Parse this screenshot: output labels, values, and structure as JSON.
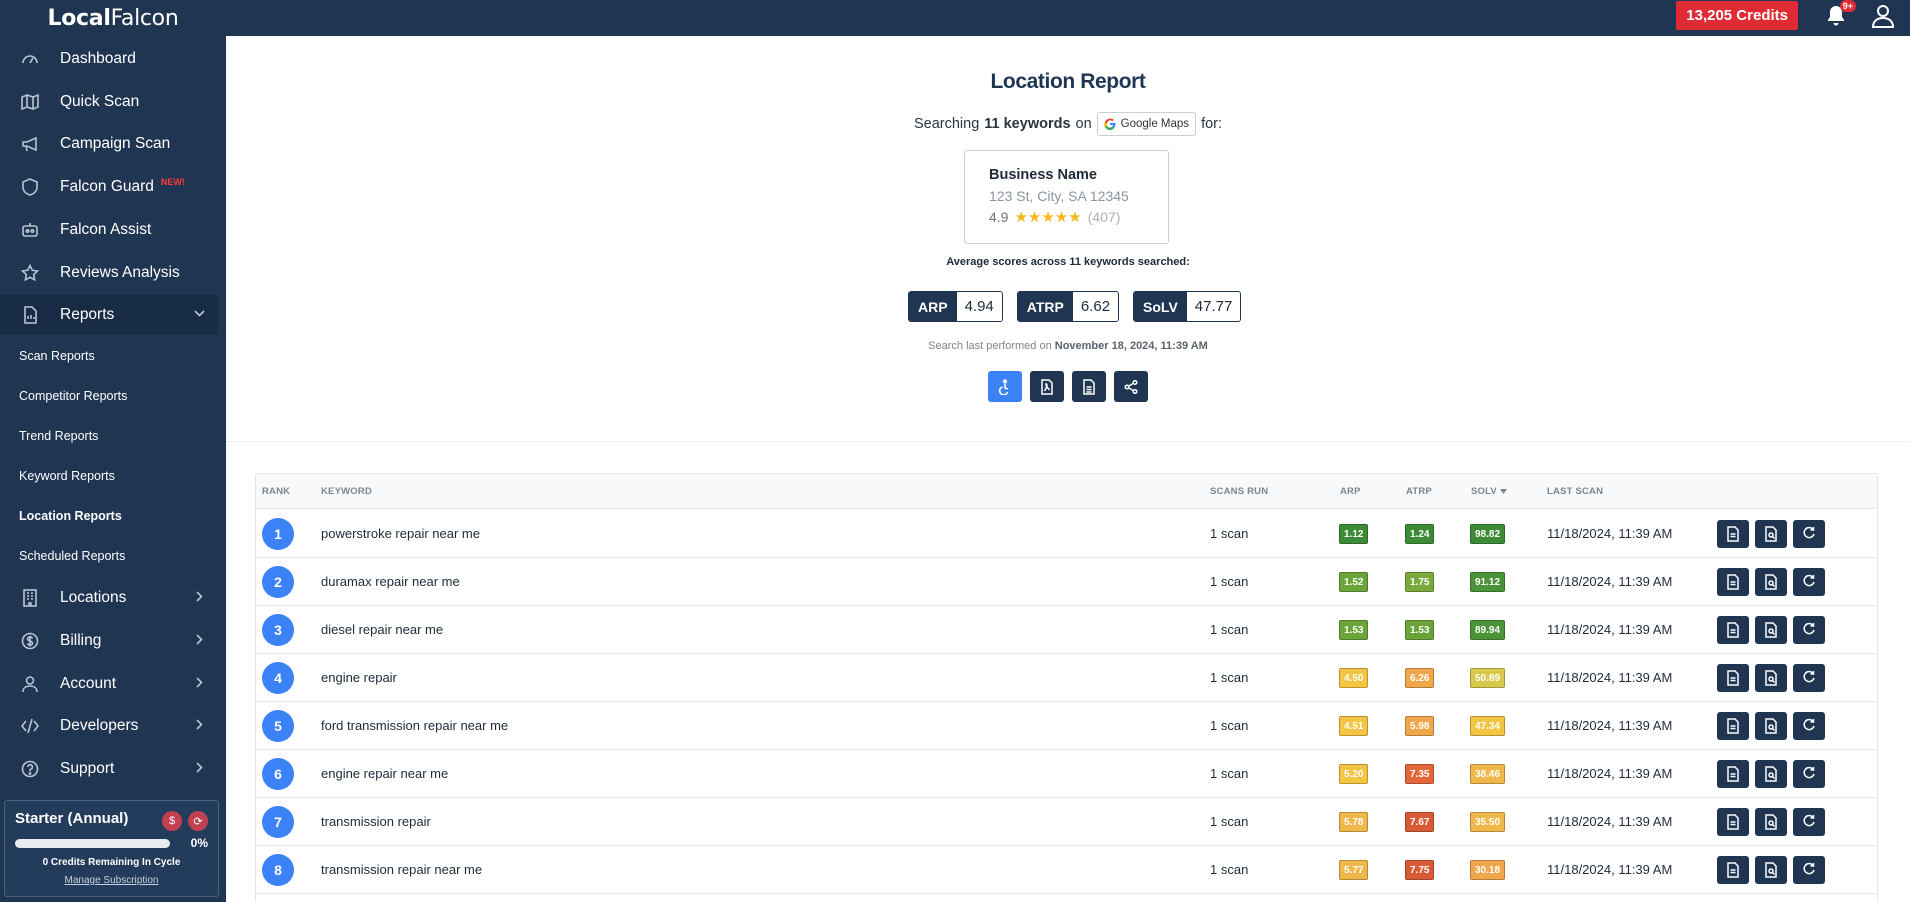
{
  "app": {
    "logo_bold": "Local",
    "logo_rest": "Falcon"
  },
  "topbar": {
    "credits": "13,205 Credits",
    "notification_count": "9+"
  },
  "sidebar": {
    "items": [
      {
        "label": "Dashboard",
        "icon": "gauge-icon"
      },
      {
        "label": "Quick Scan",
        "icon": "map-icon"
      },
      {
        "label": "Campaign Scan",
        "icon": "megaphone-icon"
      },
      {
        "label": "Falcon Guard",
        "icon": "shield-icon",
        "badge": "NEW!"
      },
      {
        "label": "Falcon Assist",
        "icon": "robot-icon"
      },
      {
        "label": "Reviews Analysis",
        "icon": "star-icon"
      },
      {
        "label": "Reports",
        "icon": "report-icon"
      },
      {
        "label": "Locations",
        "icon": "building-icon"
      },
      {
        "label": "Billing",
        "icon": "dollar-icon"
      },
      {
        "label": "Account",
        "icon": "user-icon"
      },
      {
        "label": "Developers",
        "icon": "code-icon"
      },
      {
        "label": "Support",
        "icon": "help-icon"
      }
    ],
    "report_sub": [
      "Scan Reports",
      "Competitor Reports",
      "Trend Reports",
      "Keyword Reports",
      "Location Reports",
      "Scheduled Reports"
    ],
    "plan": {
      "name": "Starter (Annual)",
      "percent": "0%",
      "credits_text": "0 Credits Remaining In Cycle",
      "manage": "Manage Subscription",
      "progress": 0
    }
  },
  "report": {
    "title": "Location Report",
    "searching_prefix": "Searching",
    "keywords_count": "11 keywords",
    "on": "on",
    "platform": "Google Maps",
    "for": "for:",
    "business": {
      "name": "Business Name",
      "address": "123 St, City, SA 12345",
      "rating": "4.9",
      "stars": "★★★★★",
      "review_count": "(407)"
    },
    "avg_text": "Average scores across 11 keywords searched:",
    "scores": [
      {
        "label": "ARP",
        "value": "4.94"
      },
      {
        "label": "ATRP",
        "value": "6.62"
      },
      {
        "label": "SoLV",
        "value": "47.77"
      }
    ],
    "last_performed_prefix": "Search last performed on",
    "last_performed_date": "November 18, 2024, 11:39 AM"
  },
  "table": {
    "headers": {
      "rank": "RANK",
      "keyword": "KEYWORD",
      "scans": "SCANS RUN",
      "arp": "ARP",
      "atrp": "ATRP",
      "solv": "SOLV",
      "last": "LAST SCAN"
    },
    "sort_icon": "caret-down-icon",
    "rows": [
      {
        "rank": "1",
        "keyword": "powerstroke repair near me",
        "scans": "1 scan",
        "arp": "1.12",
        "atrp": "1.24",
        "solv": "98.82",
        "last": "11/18/2024, 11:39 AM",
        "arp_color": "#3d8b37",
        "atrp_color": "#3d8b37",
        "solv_color": "#3d8b37"
      },
      {
        "rank": "2",
        "keyword": "duramax repair near me",
        "scans": "1 scan",
        "arp": "1.52",
        "atrp": "1.75",
        "solv": "91.12",
        "last": "11/18/2024, 11:39 AM",
        "arp_color": "#6ba53a",
        "atrp_color": "#7aaa3c",
        "solv_color": "#4a9338"
      },
      {
        "rank": "3",
        "keyword": "diesel repair near me",
        "scans": "1 scan",
        "arp": "1.53",
        "atrp": "1.53",
        "solv": "89.94",
        "last": "11/18/2024, 11:39 AM",
        "arp_color": "#6ba53a",
        "atrp_color": "#6ba53a",
        "solv_color": "#4a9338"
      },
      {
        "rank": "4",
        "keyword": "engine repair",
        "scans": "1 scan",
        "arp": "4.50",
        "atrp": "6.26",
        "solv": "50.89",
        "last": "11/18/2024, 11:39 AM",
        "arp_color": "#f4c542",
        "atrp_color": "#f0a64a",
        "solv_color": "#d9c94a"
      },
      {
        "rank": "5",
        "keyword": "ford transmission repair near me",
        "scans": "1 scan",
        "arp": "4.51",
        "atrp": "5.98",
        "solv": "47.34",
        "last": "11/18/2024, 11:39 AM",
        "arp_color": "#f4c542",
        "atrp_color": "#f0a64a",
        "solv_color": "#f4c542"
      },
      {
        "rank": "6",
        "keyword": "engine repair near me",
        "scans": "1 scan",
        "arp": "5.20",
        "atrp": "7.35",
        "solv": "38.46",
        "last": "11/18/2024, 11:39 AM",
        "arp_color": "#f4c542",
        "atrp_color": "#e2683a",
        "solv_color": "#f0b84a"
      },
      {
        "rank": "7",
        "keyword": "transmission repair",
        "scans": "1 scan",
        "arp": "5.78",
        "atrp": "7.67",
        "solv": "35.50",
        "last": "11/18/2024, 11:39 AM",
        "arp_color": "#f0b84a",
        "atrp_color": "#d95a36",
        "solv_color": "#f0b84a"
      },
      {
        "rank": "8",
        "keyword": "transmission repair near me",
        "scans": "1 scan",
        "arp": "5.77",
        "atrp": "7.75",
        "solv": "30.18",
        "last": "11/18/2024, 11:39 AM",
        "arp_color": "#f0b84a",
        "atrp_color": "#d95a36",
        "solv_color": "#f0a64a"
      }
    ]
  }
}
